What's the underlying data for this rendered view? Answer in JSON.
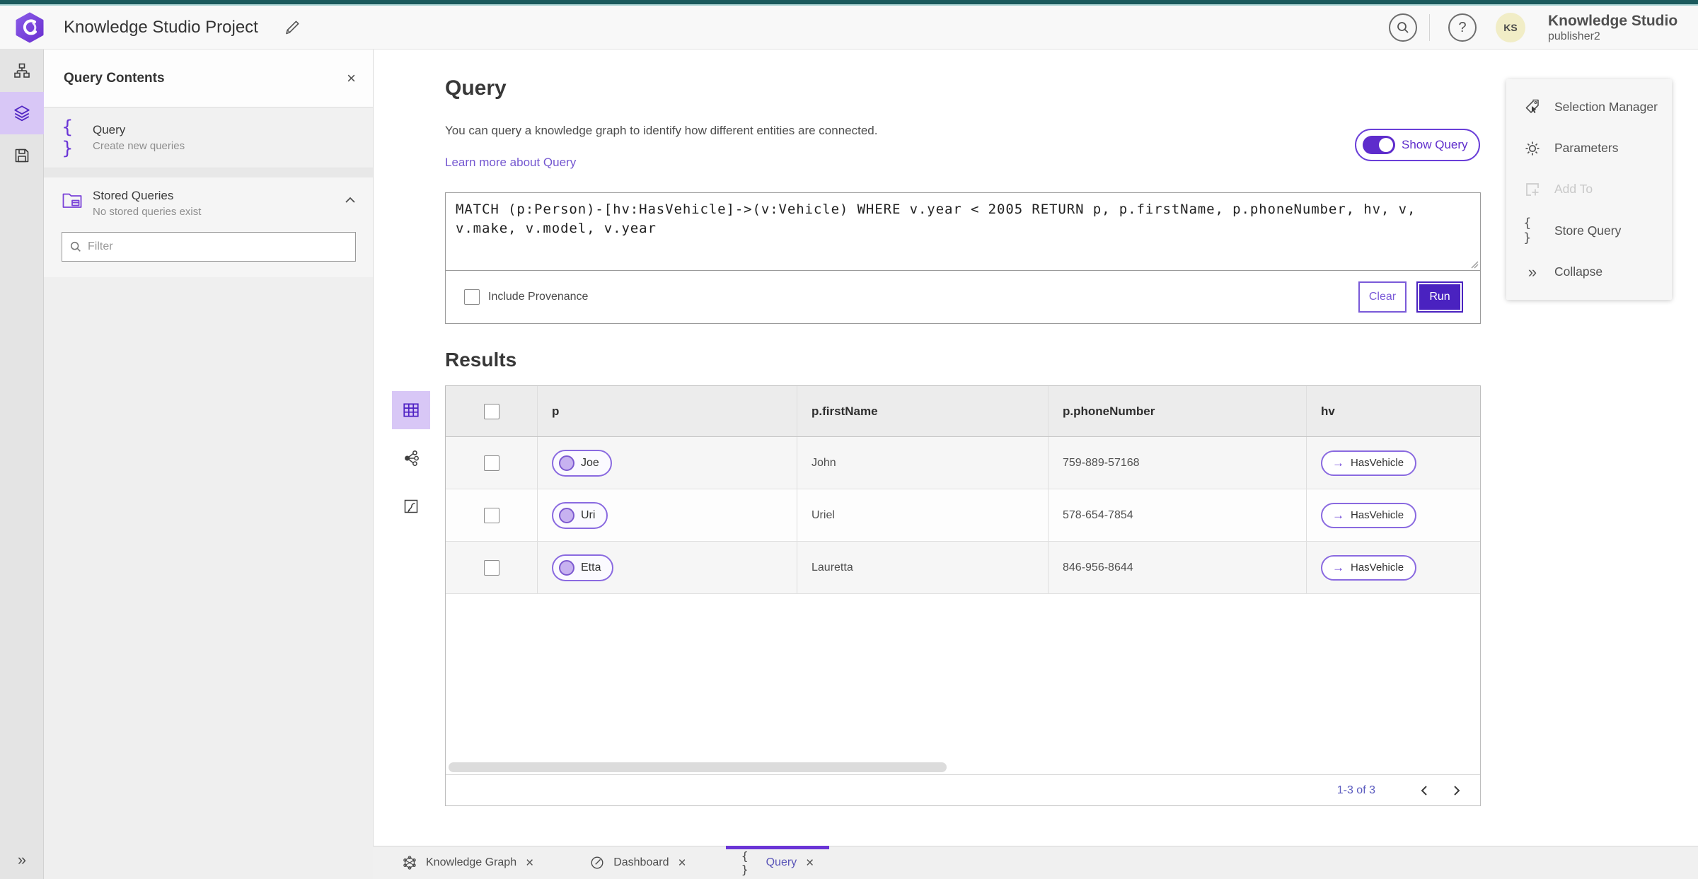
{
  "header": {
    "title": "Knowledge Studio Project",
    "product_name": "Knowledge Studio",
    "user_name": "publisher2",
    "avatar_initials": "KS",
    "help_glyph": "?"
  },
  "contents": {
    "title": "Query Contents",
    "query_item": {
      "title": "Query",
      "subtitle": "Create new queries"
    },
    "stored": {
      "title": "Stored Queries",
      "subtitle": "No stored queries exist"
    },
    "filter_placeholder": "Filter"
  },
  "query": {
    "heading": "Query",
    "description": "You can query a knowledge graph to identify how different entities are connected.",
    "learn_more": "Learn more about Query",
    "show_query": "Show Query",
    "text": "MATCH (p:Person)-[hv:HasVehicle]->(v:Vehicle) WHERE v.year < 2005 RETURN p, p.firstName, p.phoneNumber, hv, v, v.make, v.model, v.year",
    "include_provenance": "Include Provenance",
    "clear": "Clear",
    "run": "Run"
  },
  "results": {
    "heading": "Results",
    "columns": {
      "p": "p",
      "firstName": "p.firstName",
      "phoneNumber": "p.phoneNumber",
      "hv": "hv"
    },
    "rows": [
      {
        "p": "Joe",
        "firstName": "John",
        "phoneNumber": "759-889-57168",
        "hv": "HasVehicle"
      },
      {
        "p": "Uri",
        "firstName": "Uriel",
        "phoneNumber": "578-654-7854",
        "hv": "HasVehicle"
      },
      {
        "p": "Etta",
        "firstName": "Lauretta",
        "phoneNumber": "846-956-8644",
        "hv": "HasVehicle"
      }
    ],
    "arrow_glyph": "→",
    "pagination": "1-3 of 3"
  },
  "tools": {
    "selection_manager": "Selection Manager",
    "parameters": "Parameters",
    "add_to": "Add To",
    "store_query": "Store Query",
    "collapse": "Collapse"
  },
  "tabs": {
    "knowledge_graph": "Knowledge Graph",
    "dashboard": "Dashboard",
    "query": "Query"
  },
  "misc": {
    "close_glyph": "×",
    "braces_glyph": "{ }",
    "expand_glyph": "»"
  },
  "colors": {
    "accent": "#5e2ccc",
    "accent_dark": "#4a22c0",
    "accent_light": "#d8c7f6",
    "pill_border": "#8a6ae0",
    "link": "#7457d0",
    "teal_strip": "#1b5a5d",
    "avatar_bg": "#f1edc6"
  }
}
